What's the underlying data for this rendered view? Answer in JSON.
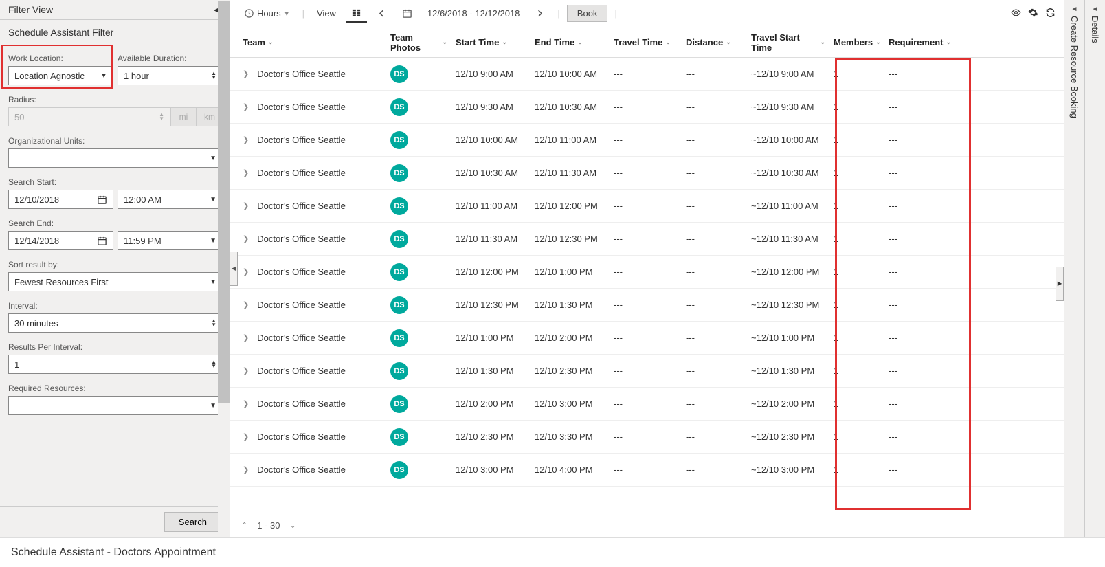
{
  "filter_panel": {
    "title": "Filter View",
    "subtitle": "Schedule Assistant Filter",
    "work_location_label": "Work Location:",
    "work_location_value": "Location Agnostic",
    "available_duration_label": "Available Duration:",
    "available_duration_value": "1 hour",
    "radius_label": "Radius:",
    "radius_value": "50",
    "unit_mi": "mi",
    "unit_km": "km",
    "org_units_label": "Organizational Units:",
    "org_units_value": "",
    "search_start_label": "Search Start:",
    "search_start_date": "12/10/2018",
    "search_start_time": "12:00 AM",
    "search_end_label": "Search End:",
    "search_end_date": "12/14/2018",
    "search_end_time": "11:59 PM",
    "sort_label": "Sort result by:",
    "sort_value": "Fewest Resources First",
    "interval_label": "Interval:",
    "interval_value": "30 minutes",
    "results_per_label": "Results Per Interval:",
    "results_per_value": "1",
    "required_resources_label": "Required Resources:",
    "required_resources_value": "",
    "search_button": "Search"
  },
  "toolbar": {
    "hours": "Hours",
    "view": "View",
    "date_range": "12/6/2018 - 12/12/2018",
    "book": "Book"
  },
  "columns": {
    "team": "Team",
    "team_photos": "Team Photos",
    "start_time": "Start Time",
    "end_time": "End Time",
    "travel_time": "Travel Time",
    "distance": "Distance",
    "travel_start_time": "Travel Start Time",
    "members": "Members",
    "requirement": "Requirement"
  },
  "avatar_initials": "DS",
  "rows": [
    {
      "team": "Doctor's Office Seattle",
      "start": "12/10 9:00 AM",
      "end": "12/10 10:00 AM",
      "travel": "---",
      "dist": "---",
      "tstart": "~12/10 9:00 AM",
      "members": "1",
      "req": "---"
    },
    {
      "team": "Doctor's Office Seattle",
      "start": "12/10 9:30 AM",
      "end": "12/10 10:30 AM",
      "travel": "---",
      "dist": "---",
      "tstart": "~12/10 9:30 AM",
      "members": "1",
      "req": "---"
    },
    {
      "team": "Doctor's Office Seattle",
      "start": "12/10 10:00 AM",
      "end": "12/10 11:00 AM",
      "travel": "---",
      "dist": "---",
      "tstart": "~12/10 10:00 AM",
      "members": "1",
      "req": "---"
    },
    {
      "team": "Doctor's Office Seattle",
      "start": "12/10 10:30 AM",
      "end": "12/10 11:30 AM",
      "travel": "---",
      "dist": "---",
      "tstart": "~12/10 10:30 AM",
      "members": "1",
      "req": "---"
    },
    {
      "team": "Doctor's Office Seattle",
      "start": "12/10 11:00 AM",
      "end": "12/10 12:00 PM",
      "travel": "---",
      "dist": "---",
      "tstart": "~12/10 11:00 AM",
      "members": "1",
      "req": "---"
    },
    {
      "team": "Doctor's Office Seattle",
      "start": "12/10 11:30 AM",
      "end": "12/10 12:30 PM",
      "travel": "---",
      "dist": "---",
      "tstart": "~12/10 11:30 AM",
      "members": "1",
      "req": "---"
    },
    {
      "team": "Doctor's Office Seattle",
      "start": "12/10 12:00 PM",
      "end": "12/10 1:00 PM",
      "travel": "---",
      "dist": "---",
      "tstart": "~12/10 12:00 PM",
      "members": "1",
      "req": "---"
    },
    {
      "team": "Doctor's Office Seattle",
      "start": "12/10 12:30 PM",
      "end": "12/10 1:30 PM",
      "travel": "---",
      "dist": "---",
      "tstart": "~12/10 12:30 PM",
      "members": "1",
      "req": "---"
    },
    {
      "team": "Doctor's Office Seattle",
      "start": "12/10 1:00 PM",
      "end": "12/10 2:00 PM",
      "travel": "---",
      "dist": "---",
      "tstart": "~12/10 1:00 PM",
      "members": "1",
      "req": "---"
    },
    {
      "team": "Doctor's Office Seattle",
      "start": "12/10 1:30 PM",
      "end": "12/10 2:30 PM",
      "travel": "---",
      "dist": "---",
      "tstart": "~12/10 1:30 PM",
      "members": "1",
      "req": "---"
    },
    {
      "team": "Doctor's Office Seattle",
      "start": "12/10 2:00 PM",
      "end": "12/10 3:00 PM",
      "travel": "---",
      "dist": "---",
      "tstart": "~12/10 2:00 PM",
      "members": "1",
      "req": "---"
    },
    {
      "team": "Doctor's Office Seattle",
      "start": "12/10 2:30 PM",
      "end": "12/10 3:30 PM",
      "travel": "---",
      "dist": "---",
      "tstart": "~12/10 2:30 PM",
      "members": "1",
      "req": "---"
    },
    {
      "team": "Doctor's Office Seattle",
      "start": "12/10 3:00 PM",
      "end": "12/10 4:00 PM",
      "travel": "---",
      "dist": "---",
      "tstart": "~12/10 3:00 PM",
      "members": "1",
      "req": "---"
    }
  ],
  "pager": {
    "range": "1 - 30"
  },
  "right_panels": {
    "create_booking": "Create Resource Booking",
    "details": "Details"
  },
  "footer": "Schedule Assistant - Doctors Appointment"
}
